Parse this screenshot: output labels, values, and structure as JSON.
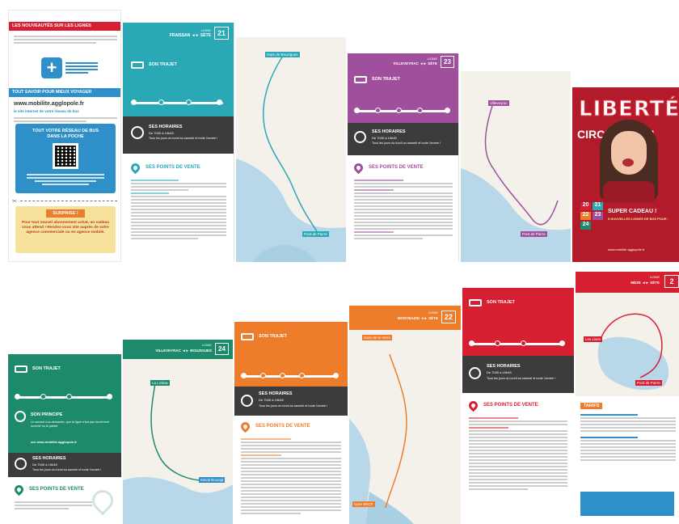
{
  "colors": {
    "teal": "#2aa8b5",
    "purple": "#a04f9c",
    "green": "#1d8a6c",
    "orange": "#ee7d2b",
    "red": "#d61f30",
    "dark": "#3c3c3c",
    "blue": "#2f8fc8",
    "sea": "#b8d8ea"
  },
  "left_panel": {
    "news_title": "LES NOUVEAUTÉS SUR LES LIGNES",
    "info_title": "TOUT SAVOIR POUR MIEUX VOYAGER",
    "site_url": "www.mobilite.agglopole.fr",
    "site_tagline": "le site internet de votre réseau de bus",
    "pocket_title": "TOUT VOTRE RÉSEAU DE BUS DANS LA POCHE",
    "surprise_title": "SURPRISE !",
    "surprise_text": "Pour tout nouvel abonnement achat, un cadeau vous attend ! Rendez-vous vite auprès de votre agence commerciale ou en agence mobile."
  },
  "line21": {
    "label": "LIGNE",
    "route": "FRAISSAN ◄► SÈTE",
    "number": "21",
    "trajet": "SON TRAJET",
    "horaires": "SES HORAIRES",
    "horaires_detail": "De 7h30 à 19h45",
    "horaires_note": "Tous les jours du lundi au samedi et fonte l'année !",
    "points": "SES POINTS DE VENTE",
    "map_start": "Gare de Bouzigues",
    "map_end": "Pont de Pierre"
  },
  "line23": {
    "label": "LIGNE",
    "route": "VILLEVEYRAC ◄► SÈTE",
    "number": "23",
    "trajet": "SON TRAJET",
    "horaires": "SES HORAIRES",
    "horaires_detail": "De 7h30 à 19h45",
    "horaires_note": "Tous les jours du lundi au samedi et toute l'année !",
    "points": "SES POINTS DE VENTE",
    "map_start": "Villeveyrac",
    "map_end": "Pont de Pierre"
  },
  "poster": {
    "title": "LIBERTÉ",
    "subtitle": "CIRCULATION",
    "gift": "SUPER CADEAU !",
    "gift_sub": "5 NOUVELLES LIGNES DE BUS POUR :",
    "lines": [
      "20",
      "21",
      "22",
      "23",
      "24"
    ],
    "url": "www.mobilite.agglopole.fr"
  },
  "line24": {
    "label": "LIGNE",
    "route": "VILLEVEYRAC ◄► BOUZIGUES",
    "number": "24",
    "trajet": "SON TRAJET",
    "principe": "SON PRINCIPE",
    "principe_text": "Le service à la demande, que la ligne n'est pas forcément ouverte ou le partiel",
    "principe_url": "sur www.mobilite.agglopole.fr",
    "horaires": "SES HORAIRES",
    "horaires_detail": "De 7h30 à 19h45",
    "horaires_note": "Tous les jours du lundi au samedi et toute l'année !",
    "points": "SES POINTS DE VENTE",
    "map_start": "La Lizàna",
    "map_end": "Mirval Bouzigl"
  },
  "line_orange": {
    "trajet": "SON TRAJET",
    "horaires": "SES HORAIRES",
    "horaires_detail": "De 7h30 à 19h45",
    "horaires_note": "Tous les jours du lundi au samedi et toute l'année !",
    "points": "SES POINTS DE VENTE"
  },
  "line22": {
    "label": "LIGNE",
    "route": "MONTBAZIN ◄► SÈTE",
    "number": "22",
    "map_start": "Gare de la Verre",
    "map_end": "Gare SNCF"
  },
  "line_red": {
    "trajet": "SON TRAJET",
    "horaires": "SES HORAIRES",
    "horaires_detail": "De 7h30 à 19h45",
    "horaires_note": "Tous les jours du lundi au samedi et toute l'année !",
    "points": "SES POINTS DE VENTE"
  },
  "line20": {
    "label": "LIGNE",
    "route": "MÈZE ◄► SÈTE",
    "number": "2",
    "map_start": "Les Lises",
    "map_end": "Pont de Pierre",
    "tarifs": "TARIFS"
  }
}
